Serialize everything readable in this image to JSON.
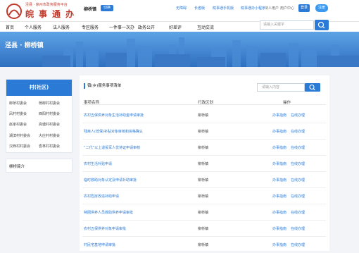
{
  "header": {
    "logo_top": "泾县 · 徐州市政务服务平台",
    "logo_main": "皖事通办",
    "region": "柳桥镇",
    "region_switch": "切换",
    "links": [
      "无障碍",
      "长者版",
      "皖事通手机版",
      "皖事通办小程序",
      "法人用户",
      "用户中心"
    ],
    "login": "登录",
    "register": "注册"
  },
  "nav": {
    "items": [
      "首页",
      "个人服务",
      "法人服务",
      "专区服务",
      "一件事一次办",
      "政务公开",
      "好差评",
      "互动交流"
    ],
    "search_placeholder": "请输入关键字"
  },
  "banner": {
    "title": "泾县 · 柳桥镇"
  },
  "sidebar": {
    "title": "村(社区)",
    "villages": [
      "柳桥村委会",
      "杨柳村村委会",
      "凤村村委会",
      "西阳村村委会",
      "赵家村委会",
      "高塘村村委会",
      "湖滨村村委会",
      "大庄村村委会",
      "汉西村村委会",
      "杏林村村委会"
    ],
    "intro": "柳桥简介"
  },
  "main": {
    "title": "镇(乡)服务事项清单",
    "search_placeholder": "请输入内容",
    "columns": [
      "事项名称",
      "行政区划",
      "操作"
    ],
    "rows": [
      {
        "name": "农村五保供养对象生活补助金申请审批",
        "dept": "柳桥镇",
        "actions": [
          "办事指南",
          "在线办理"
        ]
      },
      {
        "name": "残疾人(低保)补贴对象审核和资格确认",
        "dept": "柳桥镇",
        "actions": [
          "办事指南",
          "在线办理"
        ]
      },
      {
        "name": "“二代”以上退役军人优待证申请审核",
        "dept": "柳桥镇",
        "actions": [
          "办事指南",
          "在线办理"
        ]
      },
      {
        "name": "农村生活补贴申请",
        "dept": "柳桥镇",
        "actions": [
          "办事指南",
          "在线办理"
        ]
      },
      {
        "name": "临时救助对象认定及申请补助审批",
        "dept": "柳桥镇",
        "actions": [
          "办事指南",
          "在线办理"
        ]
      },
      {
        "name": "农村危房改造补助申请",
        "dept": "柳桥镇",
        "actions": [
          "办事指南",
          "在线办理"
        ]
      },
      {
        "name": "特困供养人员救助供养申请审批",
        "dept": "柳桥镇",
        "actions": [
          "办事指南",
          "在线办理"
        ]
      },
      {
        "name": "农村五保供养对象申请审批",
        "dept": "柳桥镇",
        "actions": [
          "办事指南",
          "在线办理"
        ]
      },
      {
        "name": "村民宅基地申请审批",
        "dept": "柳桥镇",
        "actions": [
          "办事指南",
          "在线办理"
        ]
      }
    ]
  },
  "colors": {
    "accent": "#2a7ad6",
    "logo": "#c0392b",
    "banner": "#3a7fd1"
  }
}
